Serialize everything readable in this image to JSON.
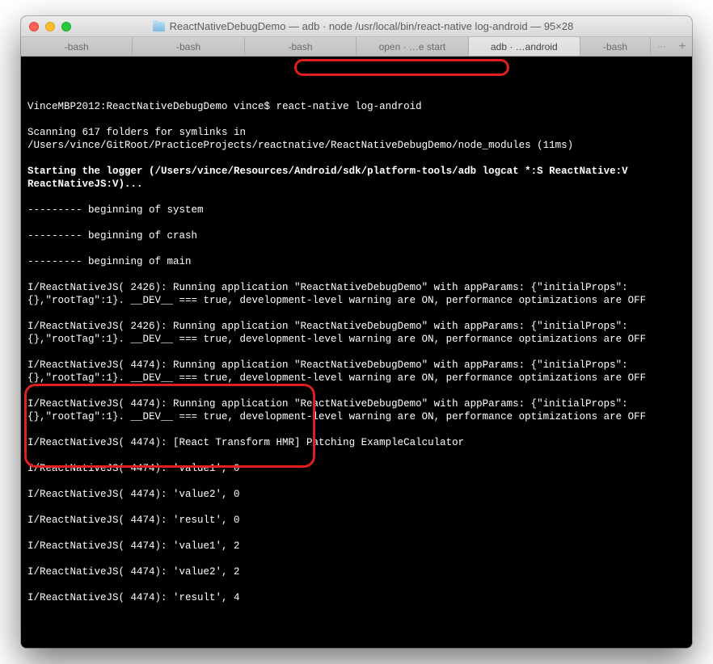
{
  "window": {
    "title": "ReactNativeDebugDemo — adb · node /usr/local/bin/react-native log-android — 95×28"
  },
  "tabs": [
    {
      "label": "-bash"
    },
    {
      "label": "-bash"
    },
    {
      "label": "-bash"
    },
    {
      "label": "open · …e start"
    },
    {
      "label": "adb · …android",
      "active": true
    },
    {
      "label": "-bash"
    }
  ],
  "term": {
    "prompt_prefix": "VinceMBP2012:ReactNativeDebugDemo vince$ ",
    "command": "react-native log-android",
    "scan_line": "Scanning 617 folders for symlinks in /Users/vince/GitRoot/PracticeProjects/reactnative/ReactNativeDebugDemo/node_modules (11ms)",
    "starting_line": "Starting the logger (/Users/vince/Resources/Android/sdk/platform-tools/adb logcat *:S ReactNative:V ReactNativeJS:V)...",
    "beg_system": "--------- beginning of system",
    "beg_crash": "--------- beginning of crash",
    "beg_main": "--------- beginning of main",
    "block1": "I/ReactNativeJS( 2426): Running application \"ReactNativeDebugDemo\" with appParams: {\"initialProps\":{},\"rootTag\":1}. __DEV__ === true, development-level warning are ON, performance optimizations are OFF",
    "block2": "I/ReactNativeJS( 2426): Running application \"ReactNativeDebugDemo\" with appParams: {\"initialProps\":{},\"rootTag\":1}. __DEV__ === true, development-level warning are ON, performance optimizations are OFF",
    "block3": "I/ReactNativeJS( 4474): Running application \"ReactNativeDebugDemo\" with appParams: {\"initialProps\":{},\"rootTag\":1}. __DEV__ === true, development-level warning are ON, performance optimizations are OFF",
    "block4": "I/ReactNativeJS( 4474): Running application \"ReactNativeDebugDemo\" with appParams: {\"initialProps\":{},\"rootTag\":1}. __DEV__ === true, development-level warning are ON, performance optimizations are OFF",
    "hmr_line": "I/ReactNativeJS( 4474): [React Transform HMR] Patching ExampleCalculator",
    "log1": "I/ReactNativeJS( 4474): 'value1', 0",
    "log2": "I/ReactNativeJS( 4474): 'value2', 0",
    "log3": "I/ReactNativeJS( 4474): 'result', 0",
    "log4": "I/ReactNativeJS( 4474): 'value1', 2",
    "log5": "I/ReactNativeJS( 4474): 'value2', 2",
    "log6": "I/ReactNativeJS( 4474): 'result', 4"
  }
}
